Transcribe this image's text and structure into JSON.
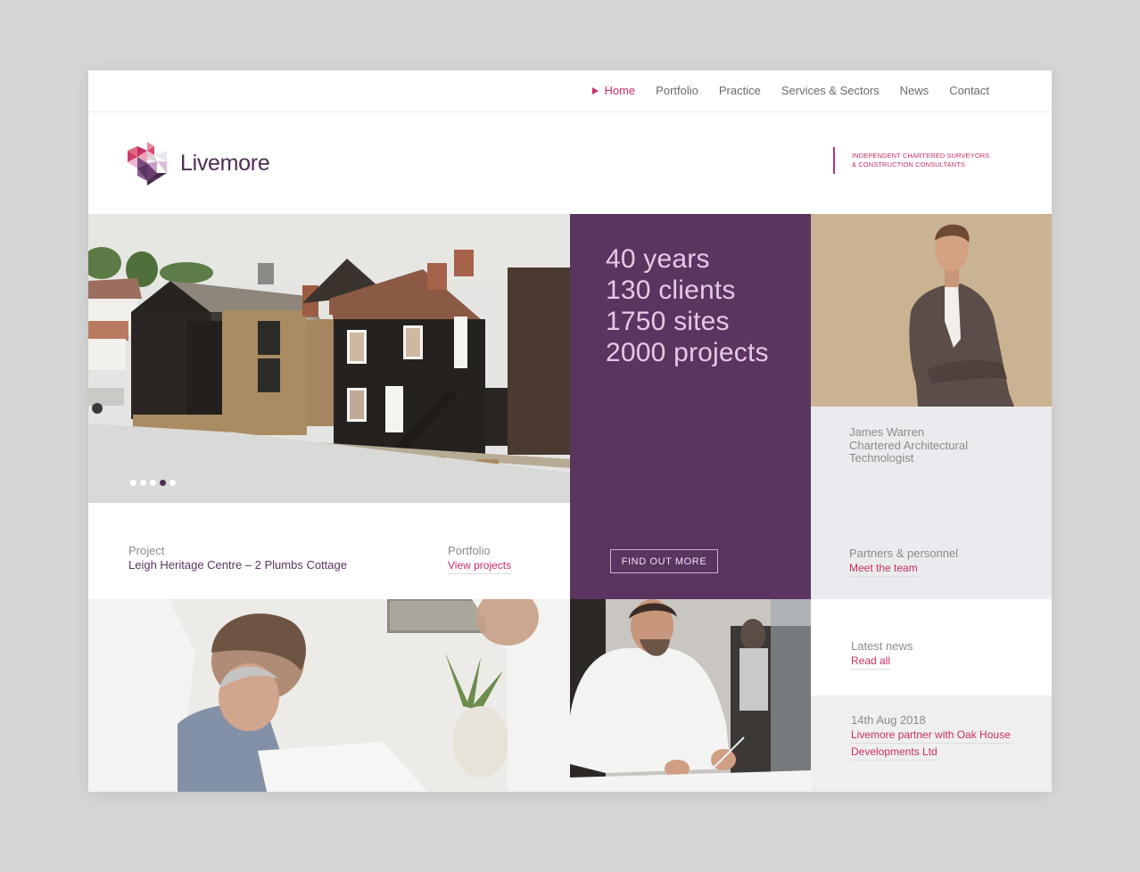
{
  "nav": {
    "items": [
      {
        "label": "Home",
        "active": true
      },
      {
        "label": "Portfolio",
        "active": false
      },
      {
        "label": "Practice",
        "active": false
      },
      {
        "label": "Services & Sectors",
        "active": false
      },
      {
        "label": "News",
        "active": false
      },
      {
        "label": "Contact",
        "active": false
      }
    ]
  },
  "header": {
    "brand": "Livemore",
    "tagline_line1": "INDEPENDENT CHARTERED SURVEYORS",
    "tagline_line2": "& CONSTRUCTION CONSULTANTS"
  },
  "colors": {
    "accent": "#c8305f",
    "brand_purple": "#5a3560",
    "panel_grey": "#e9ebee"
  },
  "hero": {
    "slides_total": 5,
    "active_slide": 4,
    "image_alt": "Leigh Heritage Centre weatherboarded buildings"
  },
  "project": {
    "label": "Project",
    "name": "Leigh Heritage Centre – 2 Plumbs Cottage",
    "portfolio_label": "Portfolio",
    "portfolio_link": "View projects"
  },
  "stats": {
    "lines": [
      "40 years",
      "130 clients",
      "1750 sites",
      "2000 projects"
    ],
    "button": "FIND OUT MORE"
  },
  "person": {
    "name": "James Warren",
    "role_line1": "Chartered Architectural",
    "role_line2": "Technologist",
    "section_label": "Partners & personnel",
    "section_link": "Meet the team"
  },
  "news": {
    "label": "Latest news",
    "link": "Read all",
    "item_date": "14th Aug 2018",
    "item_title_line1": "Livemore partner with Oak House",
    "item_title_line2": "Developments Ltd"
  }
}
